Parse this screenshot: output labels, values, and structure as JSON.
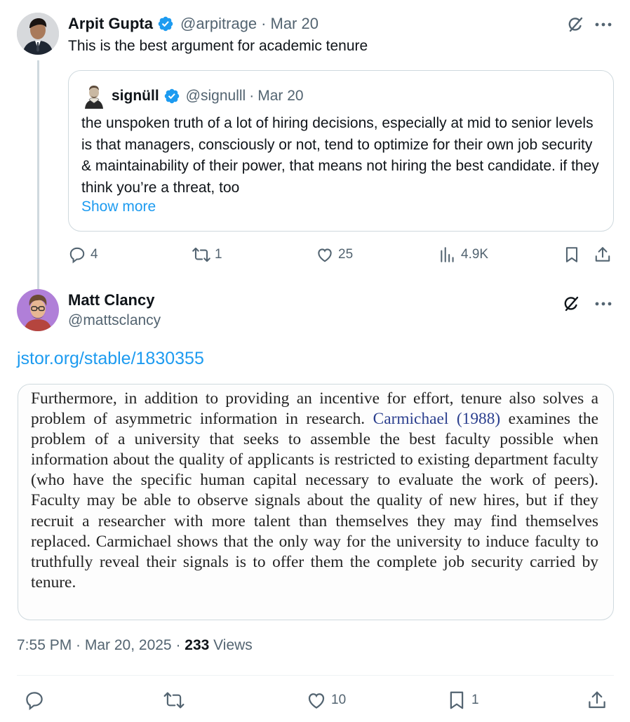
{
  "parent_tweet": {
    "author_name": "Arpit Gupta",
    "handle": "@arpitrage",
    "date": "Mar 20",
    "text": "This is the best argument for academic tenure",
    "quote": {
      "author_name": "signüll",
      "handle": "@signulll",
      "date": "Mar 20",
      "text": "the unspoken truth of a lot of hiring decisions, especially at mid to senior levels is that managers, consciously or not, tend to optimize for their own job security & maintainability of their power, that means not hiring the best candidate. if they think you’re a threat, too",
      "show_more": "Show more"
    },
    "stats": {
      "replies": "4",
      "reposts": "1",
      "likes": "25",
      "views": "4.9K"
    }
  },
  "main_tweet": {
    "author_name": "Matt Clancy",
    "handle": "@mattsclancy",
    "link": "jstor.org/stable/1830355",
    "image_text": {
      "before": "Furthermore, in addition to providing an incentive for effort, tenure also solves a problem of asymmetric information in research. ",
      "cite": "Carmichael (1988)",
      "after": " examines the problem of a university that seeks to assemble the best faculty possible when information about the quality of applicants is restricted to existing department faculty (who have the specific human capital necessary to evaluate the work of peers). Faculty may be able to observe signals about the quality of new hires, but if they recruit a researcher with more talent than themselves they may find themselves replaced. Carmichael shows that the only way for the university to induce faculty to truthfully reveal their signals is to offer them the complete job security carried by tenure."
    },
    "timestamp": "7:55 PM · Mar 20, 2025 · ",
    "views_count": "233",
    "views_label": " Views",
    "stats": {
      "likes": "10",
      "bookmarks": "1"
    }
  },
  "colors": {
    "accent": "#1d9bf0",
    "muted": "#536471",
    "border": "#cfd9de",
    "verified": "#1d9bf0"
  },
  "icons": [
    "grok-icon",
    "more-icon",
    "reply-icon",
    "repost-icon",
    "like-icon",
    "views-icon",
    "bookmark-icon",
    "share-icon",
    "verified-badge-icon"
  ]
}
